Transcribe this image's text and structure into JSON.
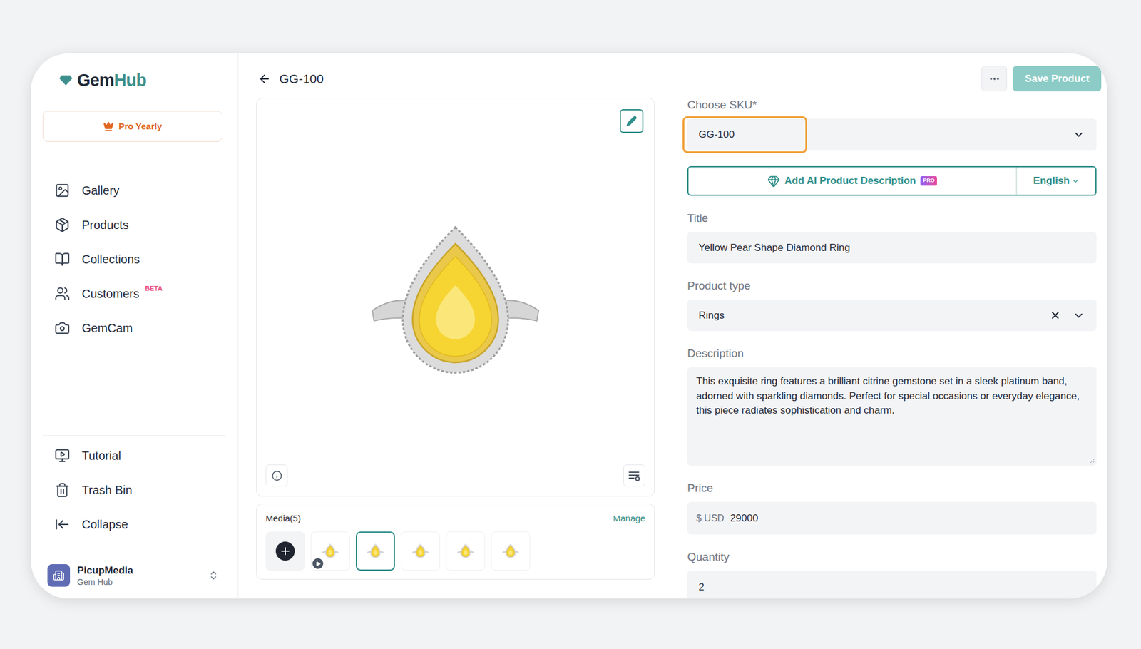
{
  "app": {
    "logo": {
      "prefix": "Gem",
      "suffix": "Hub"
    },
    "plan": "Pro Yearly"
  },
  "sidebar": {
    "items": [
      {
        "label": "Gallery"
      },
      {
        "label": "Products"
      },
      {
        "label": "Collections"
      },
      {
        "label": "Customers",
        "badge": "BETA"
      },
      {
        "label": "GemCam"
      }
    ],
    "footer_items": [
      {
        "label": "Tutorial"
      },
      {
        "label": "Trash Bin"
      },
      {
        "label": "Collapse"
      }
    ],
    "account": {
      "name": "PicupMedia",
      "org": "Gem Hub"
    }
  },
  "header": {
    "title": "GG-100",
    "save_button": {
      "label": "Save Product",
      "disabled": true
    }
  },
  "media": {
    "label": "Media(5)",
    "manage": "Manage",
    "thumbnails": [
      {
        "video": true,
        "selected": false
      },
      {
        "video": false,
        "selected": true
      },
      {
        "video": false,
        "selected": false
      },
      {
        "video": false,
        "selected": false
      },
      {
        "video": false,
        "selected": false
      }
    ]
  },
  "form": {
    "sku": {
      "label": "Choose SKU*",
      "value": "GG-100",
      "highlighted": true
    },
    "ai_button": {
      "label": "Add AI Product Description",
      "badge": "PRO",
      "language": "English"
    },
    "title": {
      "label": "Title",
      "value": "Yellow Pear Shape Diamond Ring"
    },
    "product_type": {
      "label": "Product type",
      "value": "Rings"
    },
    "description": {
      "label": "Description",
      "value": "This exquisite ring features a brilliant citrine gemstone set in a sleek platinum band, adorned with sparkling diamonds. Perfect for special occasions or everyday elegance, this piece radiates sophistication and charm."
    },
    "price": {
      "label": "Price",
      "currency": "$ USD",
      "value": "29000"
    },
    "quantity": {
      "label": "Quantity",
      "value": "2"
    }
  }
}
